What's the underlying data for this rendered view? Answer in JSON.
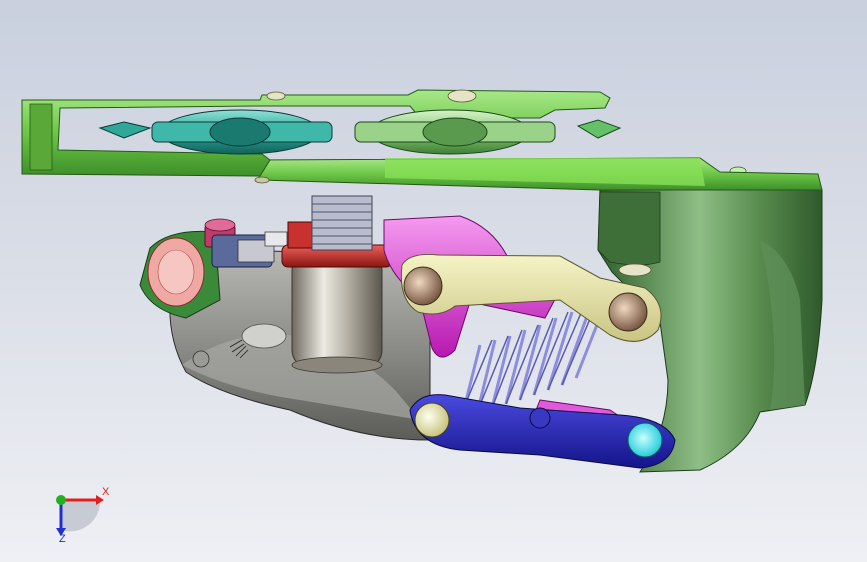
{
  "viewport": {
    "background_top": "#c9d0de",
    "background_bottom": "#eef0f4"
  },
  "model": {
    "parts": [
      {
        "name": "cage-outer-plate",
        "color": "#7fd35a"
      },
      {
        "name": "pulley-left",
        "color": "#2fa89a"
      },
      {
        "name": "pulley-right",
        "color": "#66c06a"
      },
      {
        "name": "main-body",
        "color": "#8e8e8a"
      },
      {
        "name": "b-knuckle",
        "color": "#4f8f3f"
      },
      {
        "name": "upper-link",
        "color": "#e8e6a6"
      },
      {
        "name": "lower-link",
        "color": "#2a2ab8"
      },
      {
        "name": "pivot-plate",
        "color": "#e23ad8"
      },
      {
        "name": "spring",
        "color": "#8c8ce0"
      },
      {
        "name": "cable-barrel",
        "color": "#c8322e"
      }
    ]
  },
  "triad": {
    "x_label": "X",
    "z_label": "Z",
    "x_color": "#e02020",
    "y_color": "#20b020",
    "z_color": "#2030d0"
  }
}
